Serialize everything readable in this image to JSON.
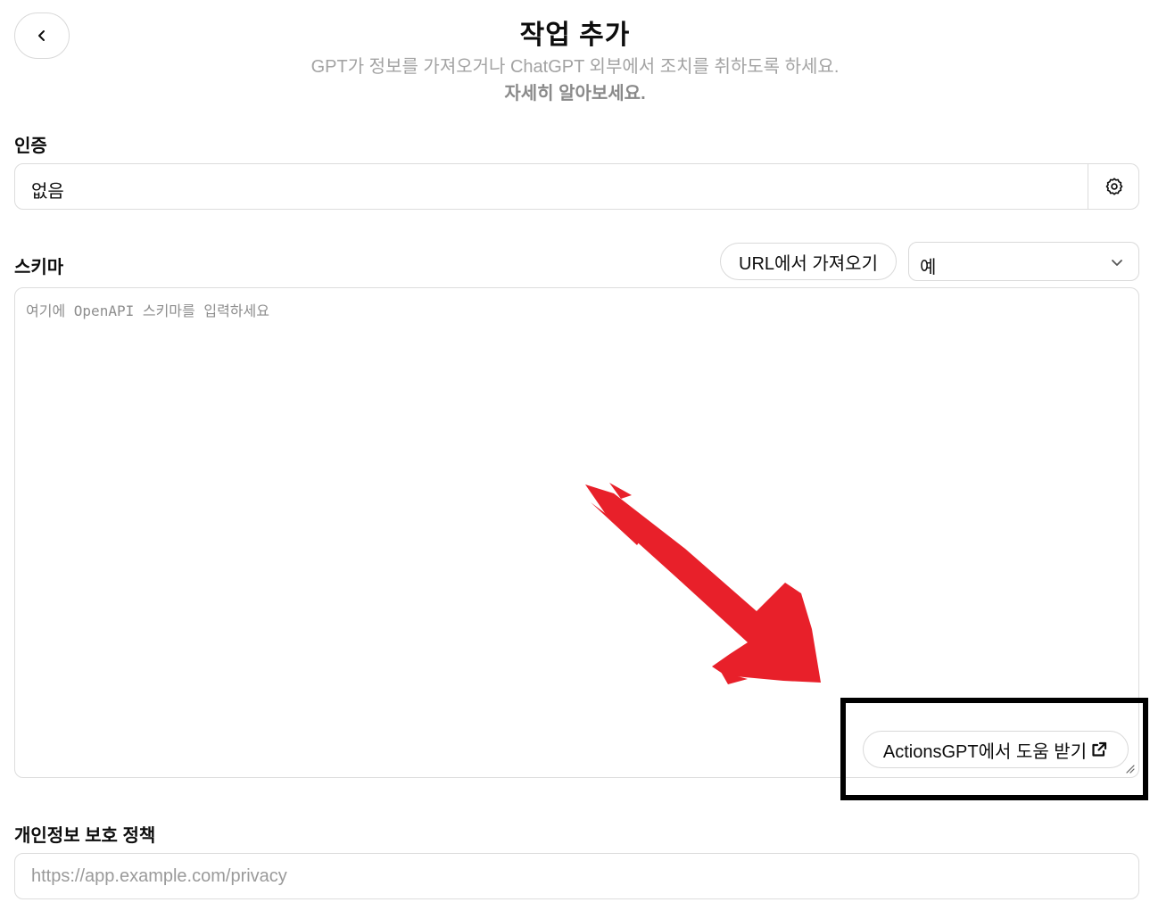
{
  "header": {
    "title": "작업 추가",
    "subtitle": "GPT가 정보를 가져오거나 ChatGPT 외부에서 조치를 취하도록 하세요.",
    "learn_more": "자세히 알아보세요.",
    "back_icon": "chevron-left-icon"
  },
  "auth": {
    "label": "인증",
    "value": "없음",
    "settings_icon": "gear-icon"
  },
  "schema": {
    "label": "스키마",
    "import_url_button": "URL에서 가져오기",
    "example_select_value": "예",
    "example_select_icon": "chevron-down-icon",
    "placeholder": "여기에 OpenAPI 스키마를 입력하세요",
    "actions_help_button": "ActionsGPT에서 도움 받기",
    "actions_help_icon": "external-link-icon"
  },
  "privacy": {
    "label": "개인정보 보호 정책",
    "placeholder": "https://app.example.com/privacy"
  },
  "annotation": {
    "arrow_color": "#e8202a",
    "highlight_color": "#000000"
  }
}
